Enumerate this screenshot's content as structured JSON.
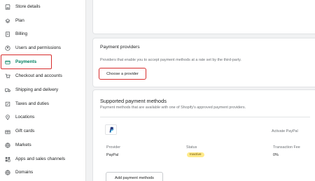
{
  "sidebar": {
    "items": [
      {
        "label": "Store details",
        "icon": "store-icon"
      },
      {
        "label": "Plan",
        "icon": "plan-icon"
      },
      {
        "label": "Billing",
        "icon": "billing-icon"
      },
      {
        "label": "Users and permissions",
        "icon": "user-icon"
      },
      {
        "label": "Payments",
        "icon": "payments-icon",
        "active": true
      },
      {
        "label": "Checkout and accounts",
        "icon": "checkout-icon"
      },
      {
        "label": "Shipping and delivery",
        "icon": "truck-icon"
      },
      {
        "label": "Taxes and duties",
        "icon": "taxes-icon"
      },
      {
        "label": "Locations",
        "icon": "location-icon"
      },
      {
        "label": "Gift cards",
        "icon": "gift-icon"
      },
      {
        "label": "Markets",
        "icon": "globe-icon"
      },
      {
        "label": "Apps and sales channels",
        "icon": "apps-icon"
      },
      {
        "label": "Domains",
        "icon": "globe-icon"
      }
    ]
  },
  "providers": {
    "title": "Payment providers",
    "description": "Providers that enable you to accept payment methods at a rate set by the third-party.",
    "button": "Choose a provider"
  },
  "supported": {
    "title": "Supported payment methods",
    "description": "Payment methods that are available with one of Shopify's approved payment providers.",
    "activate_link": "Activate PayPal",
    "columns": {
      "provider": "Provider",
      "status": "Status",
      "fee": "Transaction Fee"
    },
    "row": {
      "provider": "PayPal",
      "status": "Inactive",
      "fee": "0%"
    },
    "add_button": "Add payment methods"
  },
  "colors": {
    "accent": "#008060",
    "highlight": "#d72c2c",
    "badge_bg": "#ffea8a"
  }
}
